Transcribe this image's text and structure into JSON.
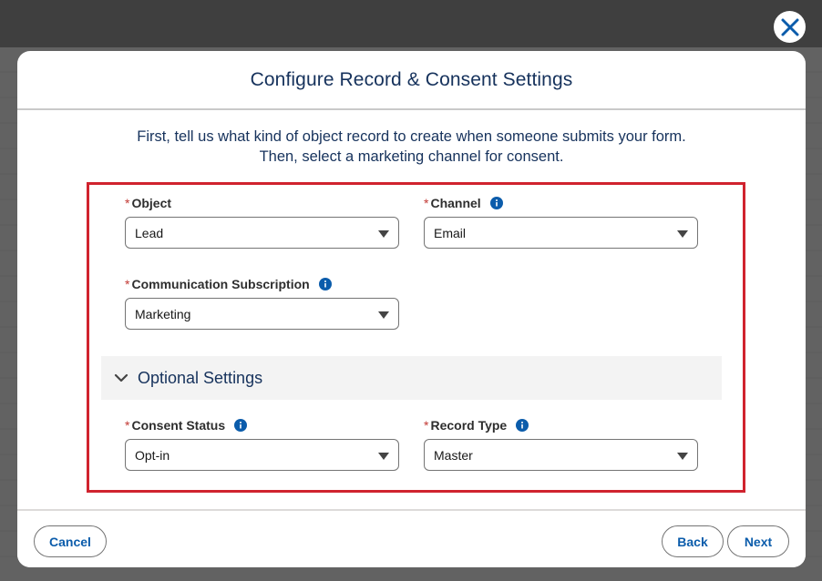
{
  "modal": {
    "title": "Configure Record & Consent Settings",
    "intro_line1": "First, tell us what kind of object record to create when someone submits your form.",
    "intro_line2": "Then, select a marketing channel for consent."
  },
  "fields": {
    "object": {
      "label": "Object",
      "value": "Lead",
      "required": "*"
    },
    "channel": {
      "label": "Channel",
      "value": "Email",
      "required": "*"
    },
    "communication_subscription": {
      "label": "Communication Subscription",
      "value": "Marketing",
      "required": "*"
    },
    "consent_status": {
      "label": "Consent Status",
      "value": "Opt-in",
      "required": "*"
    },
    "record_type": {
      "label": "Record Type",
      "value": "Master",
      "required": "*"
    }
  },
  "optional_section": {
    "title": "Optional Settings",
    "expanded": true
  },
  "footer": {
    "cancel_label": "Cancel",
    "back_label": "Back",
    "next_label": "Next"
  },
  "icons": {
    "close": "close-icon",
    "info": "info-icon",
    "chevron": "chevron-down-icon",
    "caret": "caret-down-icon"
  },
  "colors": {
    "brand_blue": "#0b5cab",
    "title_navy": "#16325c",
    "highlight_red": "#d0232e",
    "required_red": "#c23934"
  }
}
